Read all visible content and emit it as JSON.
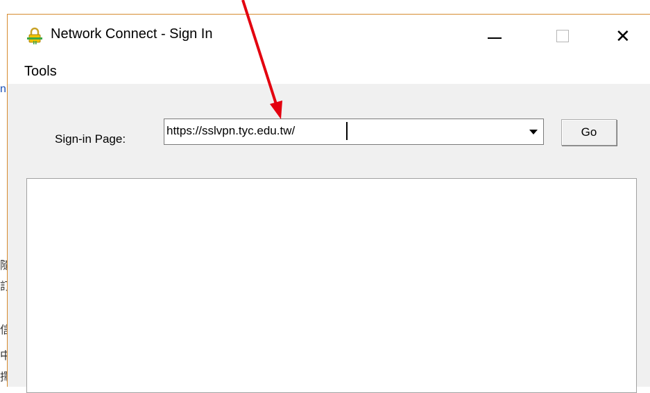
{
  "background": {
    "edge_chars": [
      "n",
      "隨",
      "訂",
      "信",
      "中",
      "擇"
    ]
  },
  "window": {
    "title": "Network Connect - Sign In",
    "icon": "padlock-icon",
    "controls": [
      "minimize-icon",
      "maximize-icon",
      "close-icon"
    ],
    "close_glyph": "✕",
    "accent_border": "#d68a2e"
  },
  "menu": {
    "items": [
      {
        "label": "Tools"
      }
    ]
  },
  "signin": {
    "label": "Sign-in Page:",
    "url_value": "https://sslvpn.tyc.edu.tw/",
    "go_label": "Go"
  },
  "annotation": {
    "type": "arrow",
    "color": "#e3000f",
    "points_to": "url-input"
  }
}
